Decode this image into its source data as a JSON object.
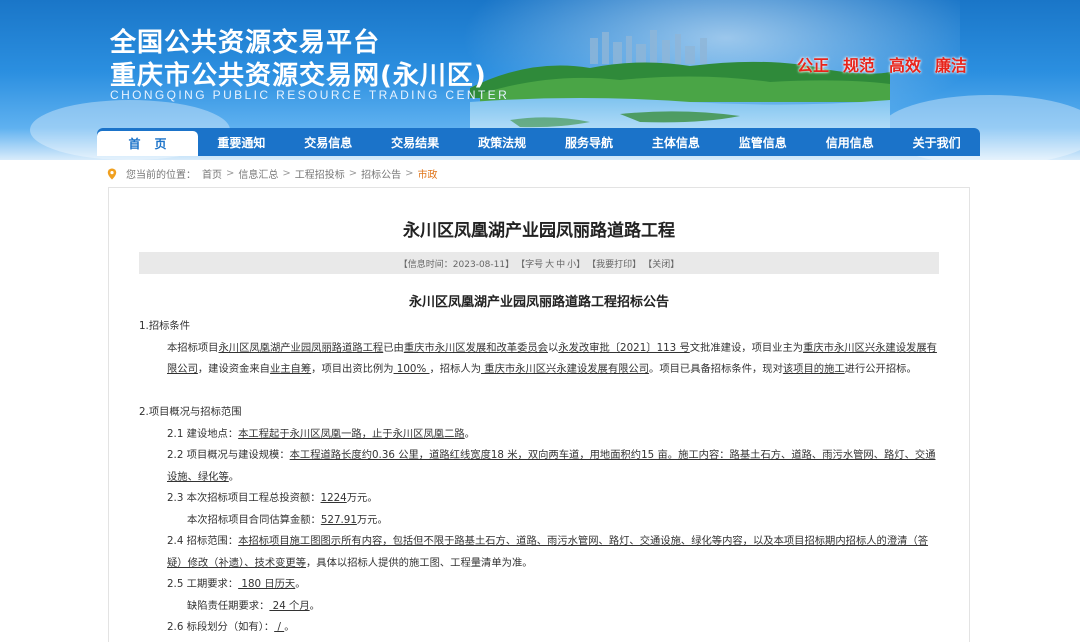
{
  "header": {
    "title_line1": "全国公共资源交易平台",
    "title_line2": "重庆市公共资源交易网(永川区)",
    "title_en": "CHONGQING PUBLIC RESOURCE TRADING CENTER",
    "slogans": [
      "公正",
      "规范",
      "高效",
      "廉洁"
    ]
  },
  "nav": {
    "items": [
      "首页",
      "重要通知",
      "交易信息",
      "交易结果",
      "政策法规",
      "服务导航",
      "主体信息",
      "监管信息",
      "信用信息",
      "关于我们"
    ]
  },
  "breadcrumb": {
    "prefix": "您当前的位置：",
    "items": [
      "首页",
      "信息汇总",
      "工程招投标",
      "招标公告",
      "市政"
    ],
    "separator": ">"
  },
  "article": {
    "title": "永川区凤凰湖产业园凤丽路道路工程",
    "info": {
      "time_label": "【信息时间：2023-08-11】",
      "font_label": "【字号",
      "font_large": "大",
      "font_medium": "中",
      "font_small": "小】",
      "print_label": "【我要打印】",
      "close_label": "【关闭】"
    },
    "notice_title": "永川区凤凰湖产业园凤丽路道路工程招标公告",
    "sec1": {
      "heading": "1.招标条件",
      "p1_a": "本招标项目",
      "p1_project": "永川区凤凰湖产业园凤丽路道路工程",
      "p1_b": "已由",
      "p1_approver": "重庆市永川区发展和改革委员会",
      "p1_c": "以",
      "p1_doc": "永发改审批〔2021〕113 号",
      "p1_d": "文批准建设，项目业主为",
      "p1_owner": "重庆市永川区兴永建设发展有限公司",
      "p1_e": "，建设资金来自",
      "p1_fund": "业主自筹",
      "p1_f": "，项目出资比例为",
      "p1_ratio": " 100% ",
      "p1_g": "，招标人为",
      "p1_tenderer": " 重庆市永川区兴永建设发展有限公司",
      "p1_h": "。项目已具备招标条件，现对",
      "p1_scope": "该项目的施工",
      "p1_i": "进行公开招标。"
    },
    "sec2": {
      "heading": "2.项目概况与招标范围",
      "l1_label": "2.1  建设地点：",
      "l1_value": "本工程起于永川区凤凰一路，止于永川区凤凰二路",
      "l1_end": "。",
      "l2_label": "2.2  项目概况与建设规模：",
      "l2_value": "本工程道路长度约0.36 公里，道路红线宽度18 米，双向两车道，用地面积约15 亩。施工内容：路基土石方、道路、雨污水管网、路灯、交通设施、绿化等",
      "l2_end": "。",
      "l3_label": "2.3  本次招标项目工程总投资额：",
      "l3_value": "1224",
      "l3_unit": "万元。",
      "l3b_label": "本次招标项目合同估算金额：",
      "l3b_value": "527.91",
      "l3b_unit": "万元。",
      "l4_label": "2.4  招标范围：",
      "l4_value": "本招标项目施工图图示所有内容，包括但不限于路基土石方、道路、雨污水管网、路灯、交通设施、绿化等内容，以及本项目招标期内招标人的澄清（答疑）修改（补遗）、技术变更等",
      "l4_rest": "，具体以招标人提供的施工图、工程量清单为准",
      "l4_end": "。",
      "l5_label": "2.5  工期要求：",
      "l5_value": " 180 日历天",
      "l5_end": "。",
      "l5b_label": "缺陷责任期要求：",
      "l5b_value": " 24 个月",
      "l5b_end": "。",
      "l6_label": "2.6  标段划分（如有）：",
      "l6_value": " / ",
      "l6_end": "。"
    }
  }
}
